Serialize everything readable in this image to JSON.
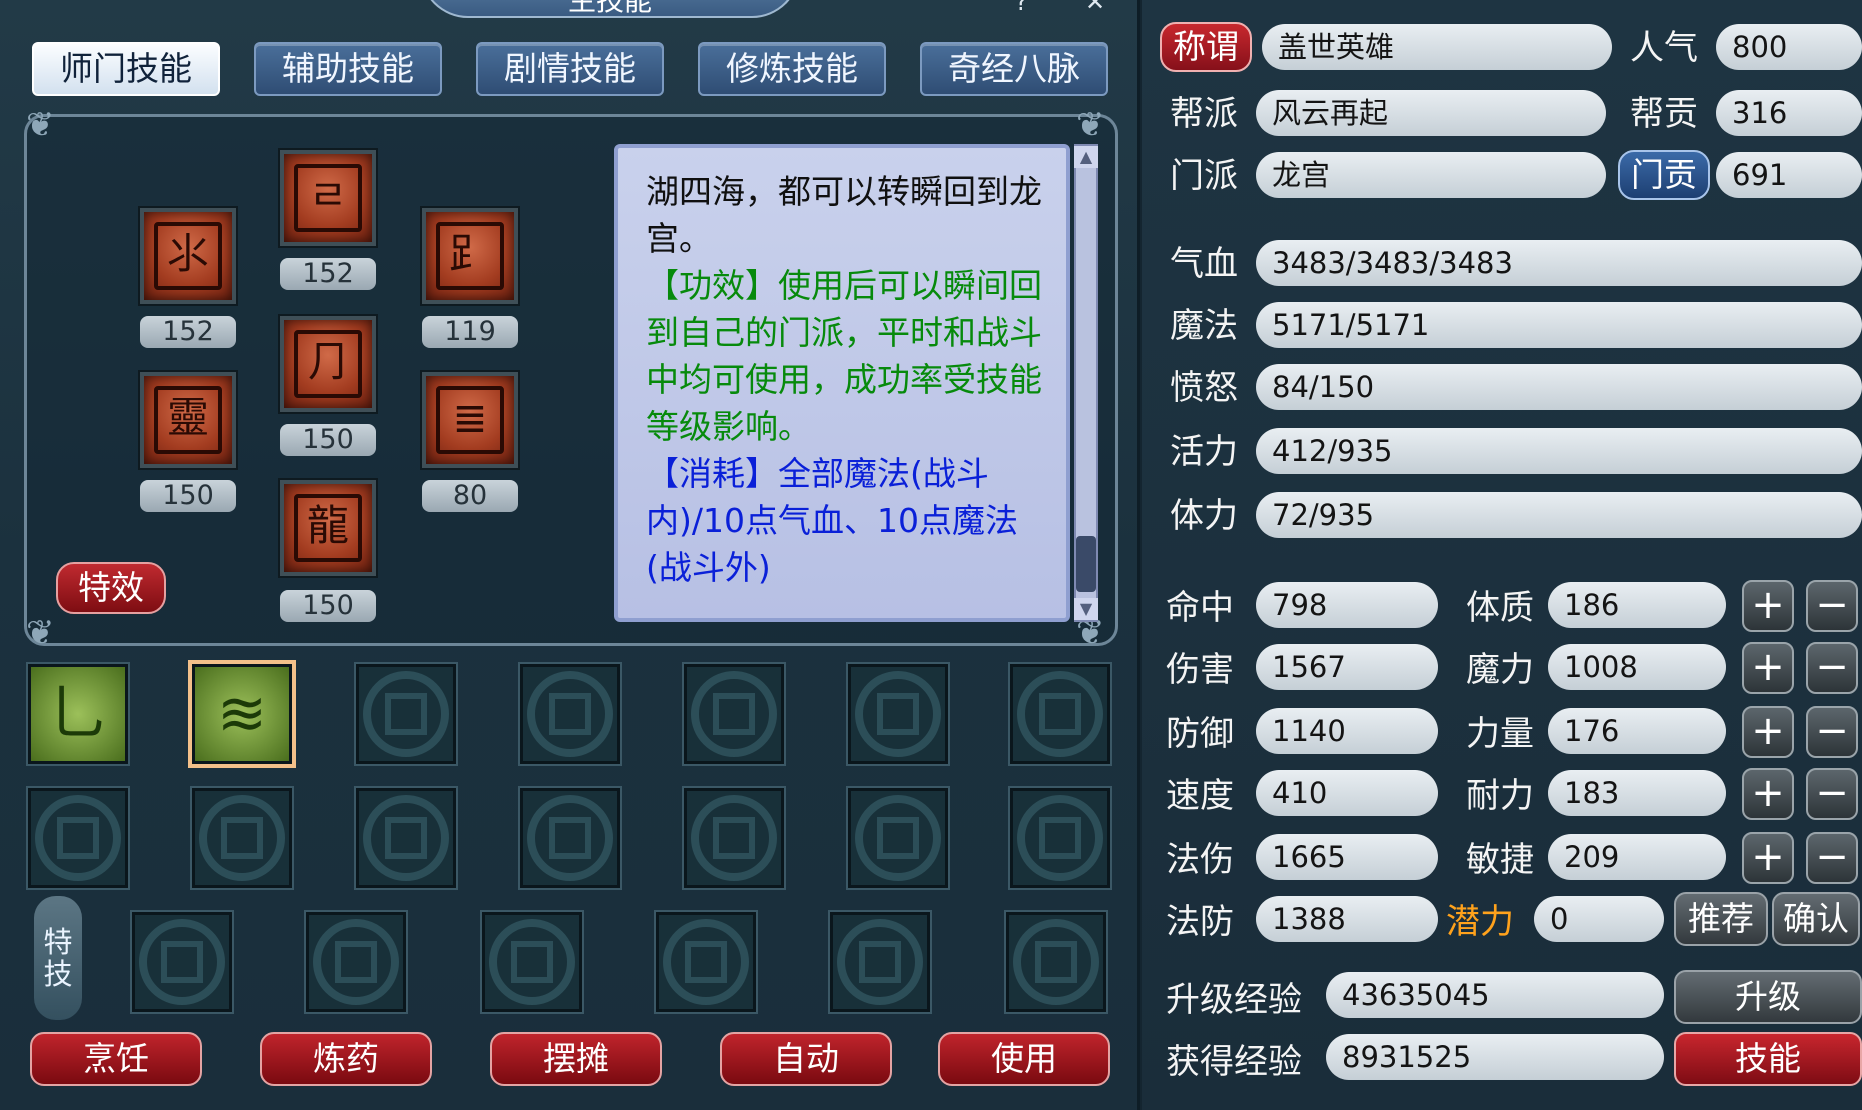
{
  "skill_window": {
    "title": "主技能",
    "tabs": [
      "师门技能",
      "辅助技能",
      "剧情技能",
      "修炼技能",
      "奇经八脉"
    ],
    "active_tab": 0,
    "skills": [
      {
        "glyph": "⺢",
        "level": "152"
      },
      {
        "glyph": "ㄹ",
        "level": "152"
      },
      {
        "glyph": "⻊",
        "level": "119"
      },
      {
        "glyph": "靈",
        "level": "150"
      },
      {
        "glyph": "⺆",
        "level": "150"
      },
      {
        "glyph": "≣",
        "level": "80"
      },
      {
        "glyph": "龍",
        "level": "150"
      }
    ],
    "effect_button": "特效",
    "description": {
      "line_black": "湖四海，都可以转瞬回到龙宫。",
      "line_green": "【功效】使用后可以瞬间回到自己的门派，平时和战斗中均可使用，成功率受技能等级影响。",
      "line_blue": "【消耗】全部魔法(战斗内)/10点气血、10点魔法(战斗外)"
    },
    "stunt_label": [
      "特",
      "技"
    ],
    "bottom_buttons": [
      "烹饪",
      "炼药",
      "摆摊",
      "自动",
      "使用"
    ]
  },
  "character": {
    "title_button": "称谓",
    "title_value": "盖世英雄",
    "popularity_label": "人气",
    "popularity": "800",
    "guild_label": "帮派",
    "guild": "风云再起",
    "guild_contrib_label": "帮贡",
    "guild_contrib": "316",
    "school_label": "门派",
    "school": "龙宫",
    "school_contrib_button": "门贡",
    "school_contrib": "691",
    "hp_label": "气血",
    "hp": "3483/3483/3483",
    "mp_label": "魔法",
    "mp": "5171/5171",
    "anger_label": "愤怒",
    "anger": "84/150",
    "vitality_label": "活力",
    "vitality": "412/935",
    "stamina_label": "体力",
    "stamina": "72/935"
  },
  "stats_left": [
    {
      "label": "命中",
      "value": "798"
    },
    {
      "label": "伤害",
      "value": "1567"
    },
    {
      "label": "防御",
      "value": "1140"
    },
    {
      "label": "速度",
      "value": "410"
    },
    {
      "label": "法伤",
      "value": "1665"
    },
    {
      "label": "法防",
      "value": "1388"
    }
  ],
  "stats_right": [
    {
      "label": "体质",
      "value": "186"
    },
    {
      "label": "魔力",
      "value": "1008"
    },
    {
      "label": "力量",
      "value": "176"
    },
    {
      "label": "耐力",
      "value": "183"
    },
    {
      "label": "敏捷",
      "value": "209"
    }
  ],
  "plus": "+",
  "minus": "−",
  "potential_label": "潜力",
  "potential": "0",
  "recommend_button": "推荐",
  "confirm_button": "确认",
  "exp_label": "升级经验",
  "exp": "43635045",
  "levelup_button": "升级",
  "gained_label": "获得经验",
  "gained": "8931525",
  "skills_button": "技能",
  "colors": {
    "accent_red": "#c0242c",
    "potential": "#ffa21c",
    "desc_green": "#078a0c",
    "desc_blue": "#0a20d8"
  }
}
